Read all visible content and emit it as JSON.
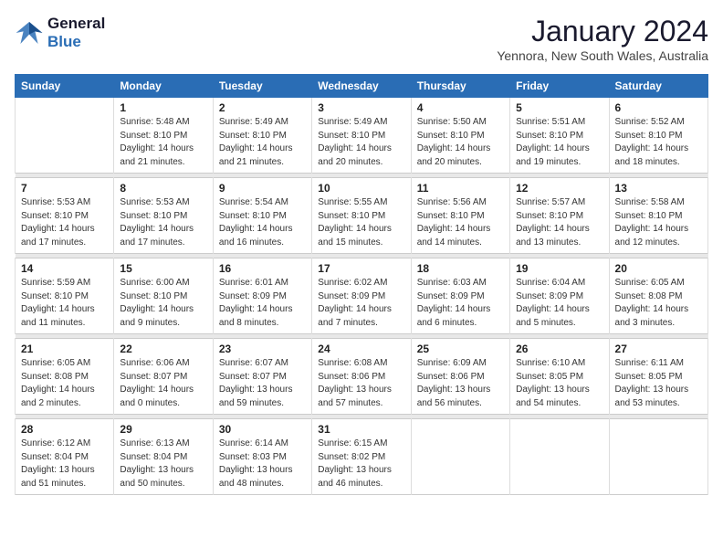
{
  "header": {
    "logo_line1": "General",
    "logo_line2": "Blue",
    "month_title": "January 2024",
    "location": "Yennora, New South Wales, Australia"
  },
  "days_of_week": [
    "Sunday",
    "Monday",
    "Tuesday",
    "Wednesday",
    "Thursday",
    "Friday",
    "Saturday"
  ],
  "weeks": [
    [
      {
        "day": "",
        "sunrise": "",
        "sunset": "",
        "daylight": ""
      },
      {
        "day": "1",
        "sunrise": "Sunrise: 5:48 AM",
        "sunset": "Sunset: 8:10 PM",
        "daylight": "Daylight: 14 hours and 21 minutes."
      },
      {
        "day": "2",
        "sunrise": "Sunrise: 5:49 AM",
        "sunset": "Sunset: 8:10 PM",
        "daylight": "Daylight: 14 hours and 21 minutes."
      },
      {
        "day": "3",
        "sunrise": "Sunrise: 5:49 AM",
        "sunset": "Sunset: 8:10 PM",
        "daylight": "Daylight: 14 hours and 20 minutes."
      },
      {
        "day": "4",
        "sunrise": "Sunrise: 5:50 AM",
        "sunset": "Sunset: 8:10 PM",
        "daylight": "Daylight: 14 hours and 20 minutes."
      },
      {
        "day": "5",
        "sunrise": "Sunrise: 5:51 AM",
        "sunset": "Sunset: 8:10 PM",
        "daylight": "Daylight: 14 hours and 19 minutes."
      },
      {
        "day": "6",
        "sunrise": "Sunrise: 5:52 AM",
        "sunset": "Sunset: 8:10 PM",
        "daylight": "Daylight: 14 hours and 18 minutes."
      }
    ],
    [
      {
        "day": "7",
        "sunrise": "Sunrise: 5:53 AM",
        "sunset": "Sunset: 8:10 PM",
        "daylight": "Daylight: 14 hours and 17 minutes."
      },
      {
        "day": "8",
        "sunrise": "Sunrise: 5:53 AM",
        "sunset": "Sunset: 8:10 PM",
        "daylight": "Daylight: 14 hours and 17 minutes."
      },
      {
        "day": "9",
        "sunrise": "Sunrise: 5:54 AM",
        "sunset": "Sunset: 8:10 PM",
        "daylight": "Daylight: 14 hours and 16 minutes."
      },
      {
        "day": "10",
        "sunrise": "Sunrise: 5:55 AM",
        "sunset": "Sunset: 8:10 PM",
        "daylight": "Daylight: 14 hours and 15 minutes."
      },
      {
        "day": "11",
        "sunrise": "Sunrise: 5:56 AM",
        "sunset": "Sunset: 8:10 PM",
        "daylight": "Daylight: 14 hours and 14 minutes."
      },
      {
        "day": "12",
        "sunrise": "Sunrise: 5:57 AM",
        "sunset": "Sunset: 8:10 PM",
        "daylight": "Daylight: 14 hours and 13 minutes."
      },
      {
        "day": "13",
        "sunrise": "Sunrise: 5:58 AM",
        "sunset": "Sunset: 8:10 PM",
        "daylight": "Daylight: 14 hours and 12 minutes."
      }
    ],
    [
      {
        "day": "14",
        "sunrise": "Sunrise: 5:59 AM",
        "sunset": "Sunset: 8:10 PM",
        "daylight": "Daylight: 14 hours and 11 minutes."
      },
      {
        "day": "15",
        "sunrise": "Sunrise: 6:00 AM",
        "sunset": "Sunset: 8:10 PM",
        "daylight": "Daylight: 14 hours and 9 minutes."
      },
      {
        "day": "16",
        "sunrise": "Sunrise: 6:01 AM",
        "sunset": "Sunset: 8:09 PM",
        "daylight": "Daylight: 14 hours and 8 minutes."
      },
      {
        "day": "17",
        "sunrise": "Sunrise: 6:02 AM",
        "sunset": "Sunset: 8:09 PM",
        "daylight": "Daylight: 14 hours and 7 minutes."
      },
      {
        "day": "18",
        "sunrise": "Sunrise: 6:03 AM",
        "sunset": "Sunset: 8:09 PM",
        "daylight": "Daylight: 14 hours and 6 minutes."
      },
      {
        "day": "19",
        "sunrise": "Sunrise: 6:04 AM",
        "sunset": "Sunset: 8:09 PM",
        "daylight": "Daylight: 14 hours and 5 minutes."
      },
      {
        "day": "20",
        "sunrise": "Sunrise: 6:05 AM",
        "sunset": "Sunset: 8:08 PM",
        "daylight": "Daylight: 14 hours and 3 minutes."
      }
    ],
    [
      {
        "day": "21",
        "sunrise": "Sunrise: 6:05 AM",
        "sunset": "Sunset: 8:08 PM",
        "daylight": "Daylight: 14 hours and 2 minutes."
      },
      {
        "day": "22",
        "sunrise": "Sunrise: 6:06 AM",
        "sunset": "Sunset: 8:07 PM",
        "daylight": "Daylight: 14 hours and 0 minutes."
      },
      {
        "day": "23",
        "sunrise": "Sunrise: 6:07 AM",
        "sunset": "Sunset: 8:07 PM",
        "daylight": "Daylight: 13 hours and 59 minutes."
      },
      {
        "day": "24",
        "sunrise": "Sunrise: 6:08 AM",
        "sunset": "Sunset: 8:06 PM",
        "daylight": "Daylight: 13 hours and 57 minutes."
      },
      {
        "day": "25",
        "sunrise": "Sunrise: 6:09 AM",
        "sunset": "Sunset: 8:06 PM",
        "daylight": "Daylight: 13 hours and 56 minutes."
      },
      {
        "day": "26",
        "sunrise": "Sunrise: 6:10 AM",
        "sunset": "Sunset: 8:05 PM",
        "daylight": "Daylight: 13 hours and 54 minutes."
      },
      {
        "day": "27",
        "sunrise": "Sunrise: 6:11 AM",
        "sunset": "Sunset: 8:05 PM",
        "daylight": "Daylight: 13 hours and 53 minutes."
      }
    ],
    [
      {
        "day": "28",
        "sunrise": "Sunrise: 6:12 AM",
        "sunset": "Sunset: 8:04 PM",
        "daylight": "Daylight: 13 hours and 51 minutes."
      },
      {
        "day": "29",
        "sunrise": "Sunrise: 6:13 AM",
        "sunset": "Sunset: 8:04 PM",
        "daylight": "Daylight: 13 hours and 50 minutes."
      },
      {
        "day": "30",
        "sunrise": "Sunrise: 6:14 AM",
        "sunset": "Sunset: 8:03 PM",
        "daylight": "Daylight: 13 hours and 48 minutes."
      },
      {
        "day": "31",
        "sunrise": "Sunrise: 6:15 AM",
        "sunset": "Sunset: 8:02 PM",
        "daylight": "Daylight: 13 hours and 46 minutes."
      },
      {
        "day": "",
        "sunrise": "",
        "sunset": "",
        "daylight": ""
      },
      {
        "day": "",
        "sunrise": "",
        "sunset": "",
        "daylight": ""
      },
      {
        "day": "",
        "sunrise": "",
        "sunset": "",
        "daylight": ""
      }
    ]
  ]
}
